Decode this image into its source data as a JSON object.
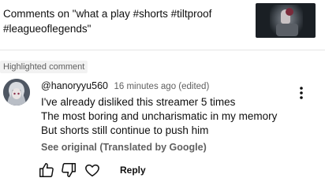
{
  "header": {
    "title": "Comments on \"what a play #shorts #tiltproof #leagueoflegends\"",
    "thumbnail_icon": "video-thumbnail"
  },
  "highlight": {
    "label": "Highlighted comment"
  },
  "comment": {
    "username": "@hanoryyu560",
    "time": "16 minutes ago (edited)",
    "lines": [
      "I've already disliked this streamer 5 times",
      "The most boring and uncharismatic in my memory",
      "But shorts still continue to push him"
    ],
    "see_original": "See original (Translated by Google)",
    "reply_label": "Reply",
    "icons": [
      "like-icon",
      "dislike-icon",
      "heart-icon",
      "more-vert-icon"
    ]
  },
  "colors": {
    "text": "#0f0f0f",
    "secondary": "#606060",
    "badge_bg": "#f2f2f2"
  }
}
